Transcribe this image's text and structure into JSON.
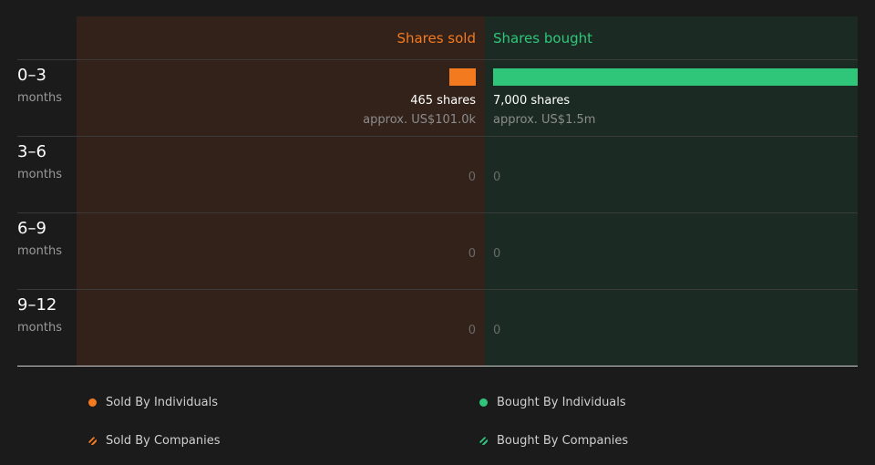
{
  "chart_data": {
    "type": "bar",
    "sold_label": "Shares sold",
    "bought_label": "Shares bought",
    "max_shares": 7000,
    "colors": {
      "sold": "#f47a20",
      "bought": "#2fc67a",
      "sold_bg": "#33221a",
      "bought_bg": "#1b2b24"
    },
    "rows": [
      {
        "range": "0–3",
        "unit": "months",
        "sold": 465,
        "bought": 7000,
        "sold_text": "465 shares",
        "sold_approx": "approx. US$101.0k",
        "bought_text": "7,000 shares",
        "bought_approx": "approx. US$1.5m"
      },
      {
        "range": "3–6",
        "unit": "months",
        "sold": 0,
        "bought": 0,
        "sold_text": "0",
        "bought_text": "0"
      },
      {
        "range": "6–9",
        "unit": "months",
        "sold": 0,
        "bought": 0,
        "sold_text": "0",
        "bought_text": "0"
      },
      {
        "range": "9–12",
        "unit": "months",
        "sold": 0,
        "bought": 0,
        "sold_text": "0",
        "bought_text": "0"
      }
    ],
    "legend": [
      {
        "label": "Sold By Individuals",
        "color": "#f47a20",
        "style": "dot"
      },
      {
        "label": "Sold By Companies",
        "color": "#f47a20",
        "style": "hatch"
      },
      {
        "label": "Bought By Individuals",
        "color": "#2fc67a",
        "style": "dot"
      },
      {
        "label": "Bought By Companies",
        "color": "#2fc67a",
        "style": "hatch"
      }
    ]
  }
}
